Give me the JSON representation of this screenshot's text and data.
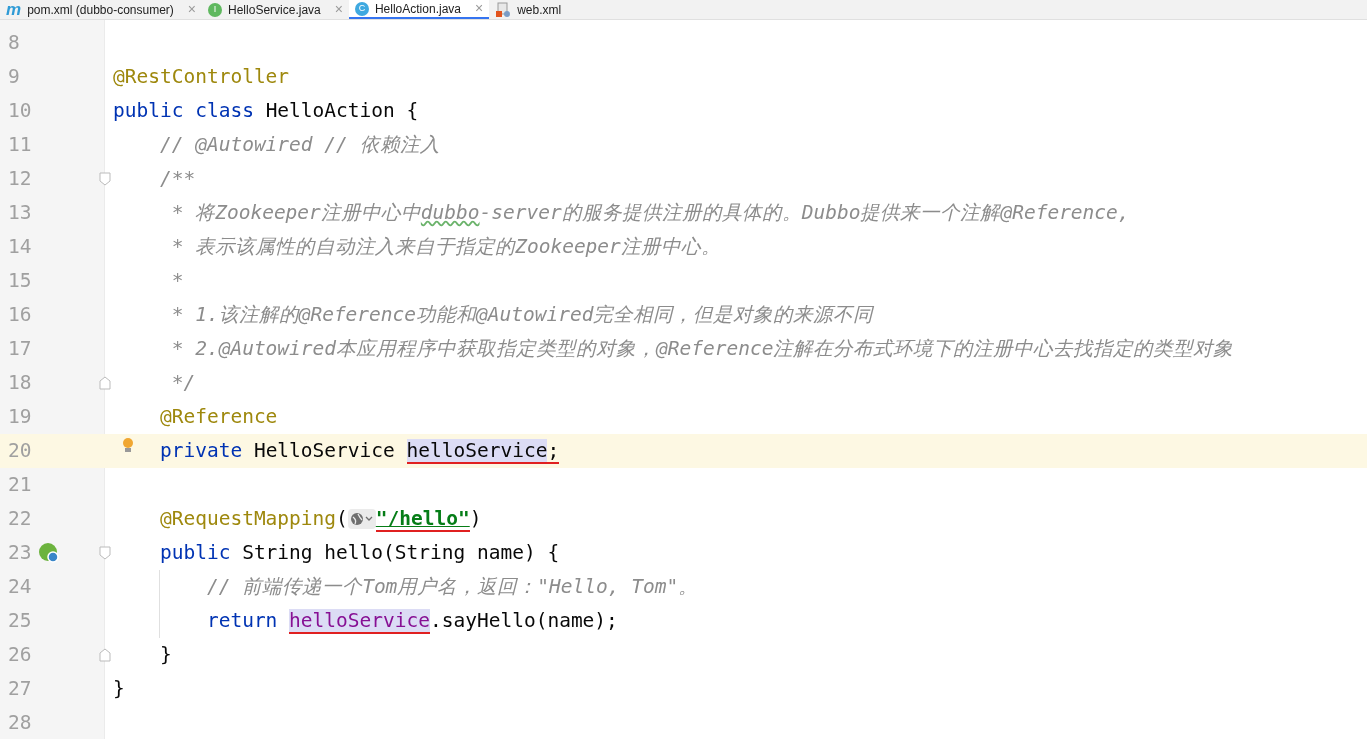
{
  "tabs": [
    {
      "kind": "maven",
      "badge": "m",
      "label": "pom.xml (dubbo-consumer)",
      "selected": false,
      "close": "×"
    },
    {
      "kind": "interface",
      "badge": "I",
      "label": "HelloService.java",
      "selected": false,
      "close": "×"
    },
    {
      "kind": "class",
      "badge": "C",
      "label": "HelloAction.java",
      "selected": true,
      "close": "×"
    },
    {
      "kind": "xml",
      "label": "web.xml",
      "selected": false
    }
  ],
  "lines": [
    {
      "number": "8"
    },
    {
      "number": "9",
      "tokens": [
        {
          "kind": "annotation",
          "text": "@RestController"
        }
      ]
    },
    {
      "number": "10",
      "tokens": [
        {
          "kind": "keyword",
          "text": "public class "
        },
        {
          "kind": "plain",
          "text": "HelloAction {"
        }
      ]
    },
    {
      "number": "11",
      "tokens": [
        {
          "kind": "comment",
          "text": "    // @Autowired // 依赖注入"
        }
      ]
    },
    {
      "number": "12",
      "fold_start": true,
      "tokens": [
        {
          "kind": "comment",
          "text": "    /**"
        }
      ]
    },
    {
      "number": "13",
      "tokens": [
        {
          "kind": "comment",
          "text": "     * 将Zookeeper注册中心中"
        },
        {
          "kind": "typo",
          "text": "dubbo"
        },
        {
          "kind": "comment",
          "text": "-server的服务提供注册的具体的。Dubbo提供来一个注解@Reference,"
        }
      ]
    },
    {
      "number": "14",
      "tokens": [
        {
          "kind": "comment",
          "text": "     * 表示该属性的自动注入来自于指定的Zookeeper注册中心。"
        }
      ]
    },
    {
      "number": "15",
      "tokens": [
        {
          "kind": "comment",
          "text": "     *"
        }
      ]
    },
    {
      "number": "16",
      "tokens": [
        {
          "kind": "comment",
          "text": "     * 1.该注解的@Reference功能和@Autowired完全相同，但是对象的来源不同"
        }
      ]
    },
    {
      "number": "17",
      "tokens": [
        {
          "kind": "comment",
          "text": "     * 2.@Autowired本应用程序中获取指定类型的对象，@Reference注解在分布式环境下的注册中心去找指定的类型对象"
        }
      ]
    },
    {
      "number": "18",
      "fold_end": true,
      "tokens": [
        {
          "kind": "comment",
          "text": "     */"
        }
      ]
    },
    {
      "number": "19",
      "tokens": [
        {
          "kind": "annotation",
          "text": "    @Reference"
        }
      ]
    },
    {
      "number": "20",
      "current": true,
      "bulb": true,
      "tokens": [
        {
          "kind": "keyword",
          "text": "    private "
        },
        {
          "kind": "plain",
          "text": "HelloService "
        },
        {
          "kind": "selected",
          "text": "helloService",
          "marked": true
        },
        {
          "kind": "plain",
          "text": ";",
          "marked": true
        }
      ]
    },
    {
      "number": "21"
    },
    {
      "number": "22",
      "tokens": [
        {
          "kind": "annotation",
          "text": "    @RequestMapping"
        },
        {
          "kind": "plain",
          "text": "("
        },
        {
          "kind": "icon"
        },
        {
          "kind": "string",
          "text": "\"/hello\"",
          "marked": true
        },
        {
          "kind": "plain",
          "text": ")"
        }
      ]
    },
    {
      "number": "23",
      "fold_start": true,
      "bean": true,
      "tokens": [
        {
          "kind": "keyword",
          "text": "    public "
        },
        {
          "kind": "plain",
          "text": "String hello(String name) {"
        }
      ]
    },
    {
      "number": "24",
      "guide": true,
      "tokens": [
        {
          "kind": "comment",
          "text": "        // 前端传递一个Tom用户名，返回：\"Hello, Tom\"。"
        }
      ]
    },
    {
      "number": "25",
      "guide": true,
      "tokens": [
        {
          "kind": "keyword",
          "text": "        return "
        },
        {
          "kind": "field",
          "text": "helloService",
          "marked": true
        },
        {
          "kind": "plain",
          "text": ".sayHello(name);"
        }
      ]
    },
    {
      "number": "26",
      "fold_end": true,
      "tokens": [
        {
          "kind": "plain",
          "text": "    }"
        }
      ]
    },
    {
      "number": "27",
      "tokens": [
        {
          "kind": "plain",
          "text": "}"
        }
      ]
    },
    {
      "number": "28"
    }
  ]
}
